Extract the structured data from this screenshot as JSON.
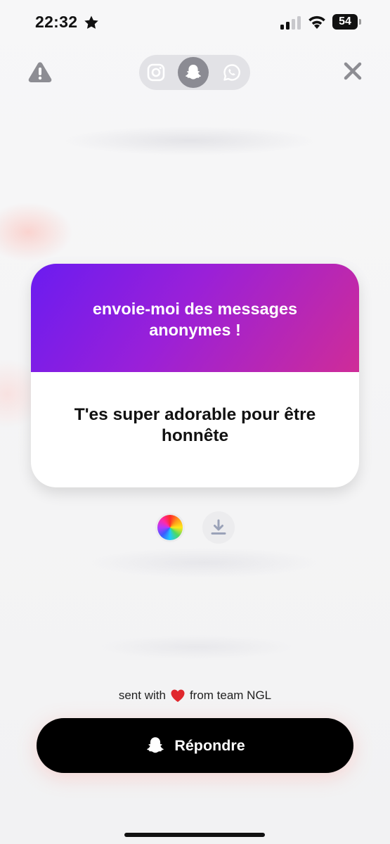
{
  "status_bar": {
    "time": "22:32",
    "battery": "54"
  },
  "top_bar": {
    "share_options": [
      "instagram",
      "snapchat",
      "whatsapp"
    ],
    "selected_share": "snapchat"
  },
  "card": {
    "header_text": "envoie-moi des messages anonymes !",
    "message": "T'es super adorable pour être honnête",
    "gradient_colors": [
      "#6b1cf0",
      "#9a20d8",
      "#cf2c98"
    ]
  },
  "footer": {
    "sent_with_prefix": "sent with",
    "sent_with_suffix": "from team NGL",
    "reply_label": "Répondre"
  },
  "colors": {
    "accent_purple": "#8a1fe0",
    "button_black": "#000000",
    "heart_red": "#e0282e"
  }
}
